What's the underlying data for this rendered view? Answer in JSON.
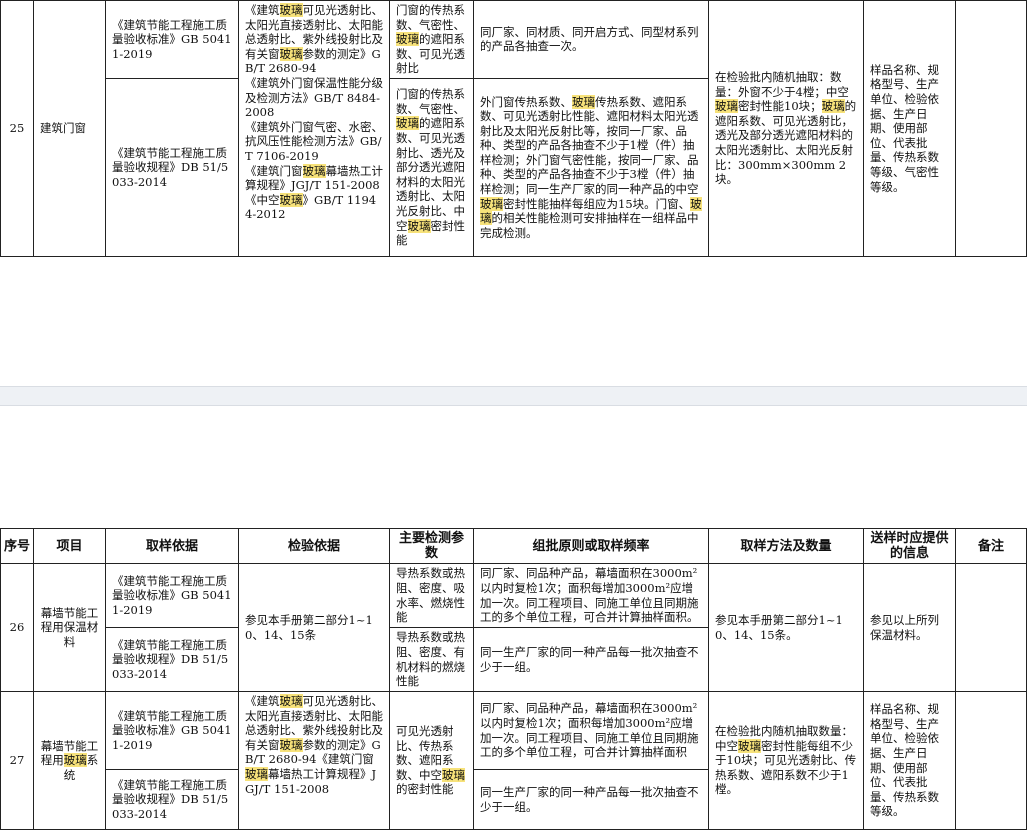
{
  "header": {
    "seq": "序号",
    "project": "项目",
    "sampling_basis": "取样依据",
    "test_basis": "检验依据",
    "main_params": "主要检测参数",
    "batch_rule": "组批原则或取样频率",
    "sampling_method": "取样方法及数量",
    "info": "送样时应提供的信息",
    "remark": "备注"
  },
  "row25": {
    "seq": "25",
    "project": "建筑门窗",
    "basis_a": "《建筑节能工程施工质量验收标准》GB 50411-2019",
    "basis_b": "《建筑节能工程施工质量验收规程》DB 51/5033-2014",
    "test_a": [
      {
        "t": "《建筑",
        "h": false
      },
      {
        "t": "玻璃",
        "h": true
      },
      {
        "t": "可见光透射比、太阳光直接透射比、太阳能总透射比、紫外线投射比及有关窗",
        "h": false
      },
      {
        "t": "玻璃",
        "h": true
      },
      {
        "t": "参数的测定》GB/T 2680-94",
        "h": false
      }
    ],
    "test_b1": "《建筑外门窗保温性能分级及检测方法》GB/T 8484-2008",
    "test_b2": "《建筑外门窗气密、水密、抗风压性能检测方法》GB/T 7106-2019",
    "test_b3": [
      {
        "t": "《建筑门窗",
        "h": false
      },
      {
        "t": "玻璃",
        "h": true
      },
      {
        "t": "幕墙热工计算规程》JGJ/T 151-2008",
        "h": false
      }
    ],
    "test_b4": [
      {
        "t": "《中空",
        "h": false
      },
      {
        "t": "玻璃",
        "h": true
      },
      {
        "t": "》GB/T 11944-2012",
        "h": false
      }
    ],
    "param_a": [
      {
        "t": "门窗的传热系数、气密性、",
        "h": false
      },
      {
        "t": "玻璃",
        "h": true
      },
      {
        "t": "的遮阳系数、可见光透射比",
        "h": false
      }
    ],
    "param_b": [
      {
        "t": "门窗的传热系数、气密性、",
        "h": false
      },
      {
        "t": "玻璃",
        "h": true
      },
      {
        "t": "的遮阳系数、可见光透射比、透光及部分透光遮阳材料的太阳光透射比、太阳光反射比、中空",
        "h": false
      },
      {
        "t": "玻璃",
        "h": true
      },
      {
        "t": "密封性能",
        "h": false
      }
    ],
    "batch_a": "同厂家、同材质、同开启方式、同型材系列的产品各抽查一次。",
    "batch_b": [
      {
        "t": "外门窗传热系数、",
        "h": false
      },
      {
        "t": "玻璃",
        "h": true
      },
      {
        "t": "传热系数、遮阳系数、可见光透射比性能、遮阳材料太阳光透射比及太阳光反射比等，按同一厂家、品种、类型的产品各抽查不少于1樘（件）抽样检测；外门窗气密性能，按同一厂家、品种、类型的产品各抽查不少于3樘（件）抽样检测；同一生产厂家的同一种产品的中空",
        "h": false
      },
      {
        "t": "玻璃",
        "h": true
      },
      {
        "t": "密封性能抽样每组应为15块。门窗、",
        "h": false
      },
      {
        "t": "玻璃",
        "h": true
      },
      {
        "t": "的相关性能检测可安排抽样在一组样品中完成检测。",
        "h": false
      }
    ],
    "method": [
      {
        "t": "在检验批内随机抽取：数量：外窗不少于4樘；中空",
        "h": false
      },
      {
        "t": "玻璃",
        "h": true
      },
      {
        "t": "密封性能10块；",
        "h": false
      },
      {
        "t": "玻璃",
        "h": true
      },
      {
        "t": "的遮阳系数、可见光透射比，透光及部分透光遮阳材料的太阳光透射比、太阳光反射比：300mm×300mm 2块。",
        "h": false
      }
    ],
    "info": "样品名称、规格型号、生产单位、检验依据、生产日期、使用部位、代表批量、传热系数等级、气密性等级。",
    "remark": ""
  },
  "row26": {
    "seq": "26",
    "project": "幕墙节能工程用保温材料",
    "basis_a": "《建筑节能工程施工质量验收标准》GB 50411-2019",
    "basis_b": "《建筑节能工程施工质量验收规程》DB 51/5033-2014",
    "test": "参见本手册第二部分1~10、14、15条",
    "param_a": "导热系数或热阻、密度、吸水率、燃烧性能",
    "param_b": "导热系数或热阻、密度、有机材料的燃烧性能",
    "batch_a": "同厂家、同品种产品，幕墙面积在3000m²以内时复检1次；面积每增加3000m²应增加一次。同工程项目、同施工单位且同期施工的多个单位工程，可合并计算抽样面积。",
    "batch_b": "同一生产厂家的同一种产品每一批次抽查不少于一组。",
    "method": "参见本手册第二部分1~10、14、15条。",
    "info": "参见以上所列保温材料。",
    "remark": ""
  },
  "row27": {
    "seq": "27",
    "project": [
      {
        "t": "幕墙节能工程用",
        "h": false
      },
      {
        "t": "玻璃",
        "h": true
      },
      {
        "t": "系统",
        "h": false
      }
    ],
    "basis_a": "《建筑节能工程施工质量验收标准》GB 50411-2019",
    "basis_b": "《建筑节能工程施工质量验收规程》DB 51/5033-2014",
    "test": [
      {
        "t": "《建筑",
        "h": false
      },
      {
        "t": "玻璃",
        "h": true
      },
      {
        "t": "可见光透射比、太阳光直接透射比、太阳能总透射比、紫外线投射比及有关窗",
        "h": false
      },
      {
        "t": "玻璃",
        "h": true
      },
      {
        "t": "参数的测定》GB/T 2680-94《建筑门窗",
        "h": false
      },
      {
        "t": "玻璃",
        "h": true
      },
      {
        "t": "幕墙热工计算规程》JGJ/T 151-2008",
        "h": false
      }
    ],
    "param": [
      {
        "t": "可见光透射比、传热系数、遮阳系数、中空",
        "h": false
      },
      {
        "t": "玻璃",
        "h": true
      },
      {
        "t": "的密封性能",
        "h": false
      }
    ],
    "batch_a": "同厂家、同品种产品，幕墙面积在3000m²以内时复检1次；面积每增加3000m²应增加一次。同工程项目、同施工单位且同期施工的多个单位工程，可合并计算抽样面积",
    "batch_b": "同一生产厂家的同一种产品每一批次抽查不少于一组。",
    "method": [
      {
        "t": "在检验批内随机抽取数量：中空",
        "h": false
      },
      {
        "t": "玻璃",
        "h": true
      },
      {
        "t": "密封性能每组不少于10块；可见光透射比、传热系数、遮阳系数不少于1樘。",
        "h": false
      }
    ],
    "info": "样品名称、规格型号、生产单位、检验依据、生产日期、使用部位、代表批量、传热系数等级。",
    "remark": ""
  }
}
